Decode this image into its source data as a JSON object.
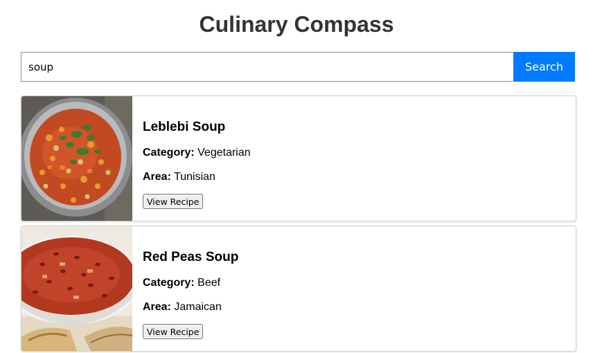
{
  "app": {
    "title": "Culinary Compass"
  },
  "search": {
    "value": "soup",
    "button_label": "Search"
  },
  "results": [
    {
      "name": "Leblebi Soup",
      "category_label": "Category:",
      "category": "Vegetarian",
      "area_label": "Area:",
      "area": "Tunisian",
      "button_label": "View Recipe"
    },
    {
      "name": "Red Peas Soup",
      "category_label": "Category:",
      "category": "Beef",
      "area_label": "Area:",
      "area": "Jamaican",
      "button_label": "View Recipe"
    }
  ],
  "colors": {
    "accent": "#007bff",
    "title": "#333333"
  }
}
